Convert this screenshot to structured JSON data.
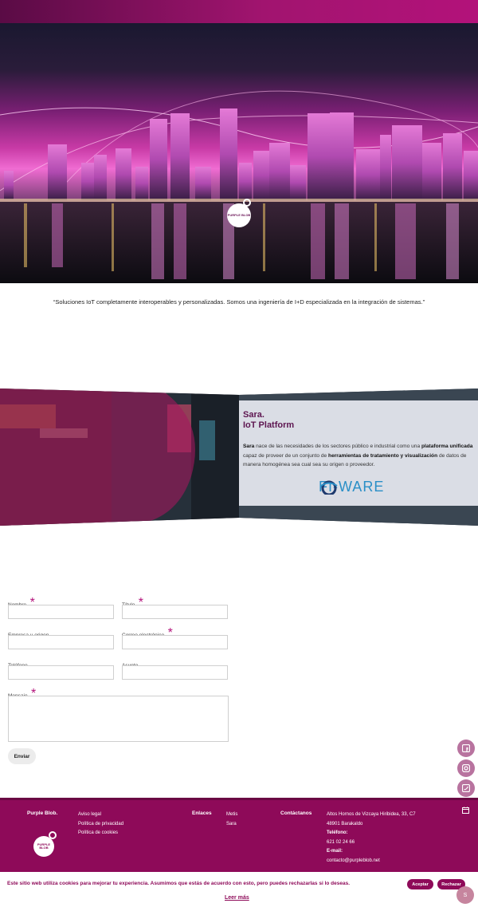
{
  "hero": {
    "logo_text": "PURPLE BLOB"
  },
  "tagline": "“Soluciones IoT completamente interoperables y personalizadas. Somos una ingeniería de I+D especializada en la integración de sistemas.”",
  "sara": {
    "title_line1": "Sara.",
    "title_line2": "IoT Platform",
    "text_1": "Sara",
    "text_2": " nace de las necesidades de los sectores público e industrial como una ",
    "text_3": "plataforma unificada",
    "text_4": " capaz de proveer de un conjunto de ",
    "text_5": "herramientas de tratamiento y visualización",
    "text_6": " de datos de manera homogénea sea cual sea su origen o proveedor.",
    "partner_logo": "FI-WARE"
  },
  "form": {
    "nombre_label": "Nombre",
    "titulo_label": "Título",
    "empresa_label": "Empresa u origen",
    "correo_label": "Correo electrónico",
    "telefono_label": "Teléfono",
    "asunto_label": "Asunto",
    "mensaje_label": "Mensaje",
    "required_mark": "*",
    "send_label": "Enviar"
  },
  "social": {
    "icons": [
      "facebook-icon",
      "instagram-icon",
      "twitter-icon"
    ]
  },
  "footer": {
    "brand": "Purple Blob.",
    "logo_text": "PURPLE BLOB",
    "legal_links": [
      "Aviso legal",
      "Política de privacidad",
      "Política de cookies"
    ],
    "enlaces_heading": "Enlaces",
    "enlaces": [
      "Metis",
      "Sara"
    ],
    "contact_heading": "Contáctanos",
    "address_line1": "Altos Hornos de Vizcaya Hiribidea, 33, C7",
    "address_line2": "48901 Barakaldo",
    "phone_label": "Teléfono:",
    "phone": "621 02 24 66",
    "email_label": "E-mail:",
    "email": "contacto@purpleblob.net"
  },
  "cookie": {
    "text": "Este sitio web utiliza cookies para mejorar tu experiencia. Asumimos que estás de acuerdo con esto, pero puedes rechazarlas si lo deseas.",
    "accept_label": "Aceptar",
    "reject_label": "Rechazar",
    "read_more_label": "Leer más"
  },
  "colors": {
    "brand": "#8e0a59",
    "accent": "#b3127a"
  }
}
